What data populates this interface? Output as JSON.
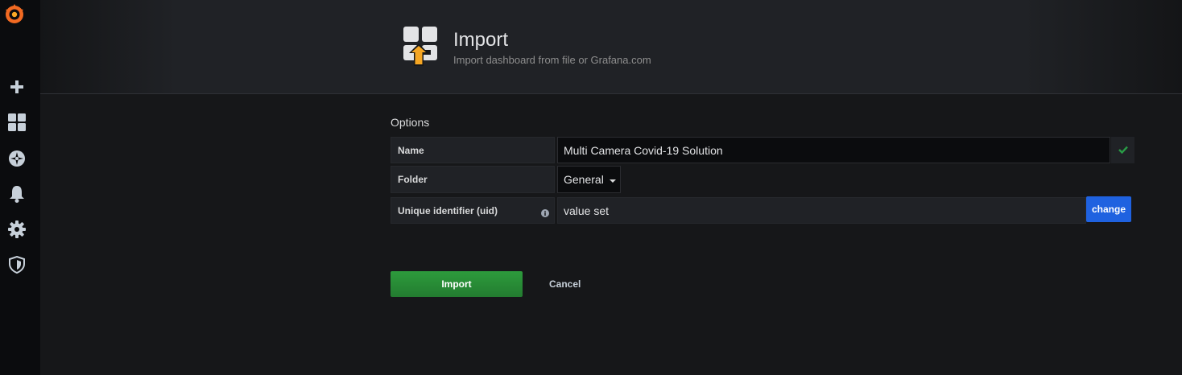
{
  "colors": {
    "sidebar_bg": "#0b0c0e",
    "page_bg": "#161719",
    "primary_button": "#1f62e0",
    "success_button": "#299c46",
    "valid_check": "#299c46",
    "grafana_orange": "#f26a22"
  },
  "sidebar": {
    "logo": "grafana-logo",
    "items": [
      {
        "icon": "plus-icon"
      },
      {
        "icon": "dashboards-icon"
      },
      {
        "icon": "explore-compass-icon"
      },
      {
        "icon": "alerting-bell-icon"
      },
      {
        "icon": "configuration-gear-icon"
      },
      {
        "icon": "server-admin-shield-icon"
      }
    ]
  },
  "header": {
    "icon": "import-dashboard-icon",
    "title": "Import",
    "subtitle": "Import dashboard from file or Grafana.com"
  },
  "form": {
    "section_label": "Options",
    "name": {
      "label": "Name",
      "value": "Multi Camera Covid-19 Solution",
      "valid_icon": "check-icon"
    },
    "folder": {
      "label": "Folder",
      "selected": "General",
      "icon": "caret-down-icon"
    },
    "uid": {
      "label": "Unique identifier (uid)",
      "info_icon": "info-circle-icon",
      "value": "value set",
      "change_label": "change"
    }
  },
  "actions": {
    "import_label": "Import",
    "cancel_label": "Cancel"
  }
}
